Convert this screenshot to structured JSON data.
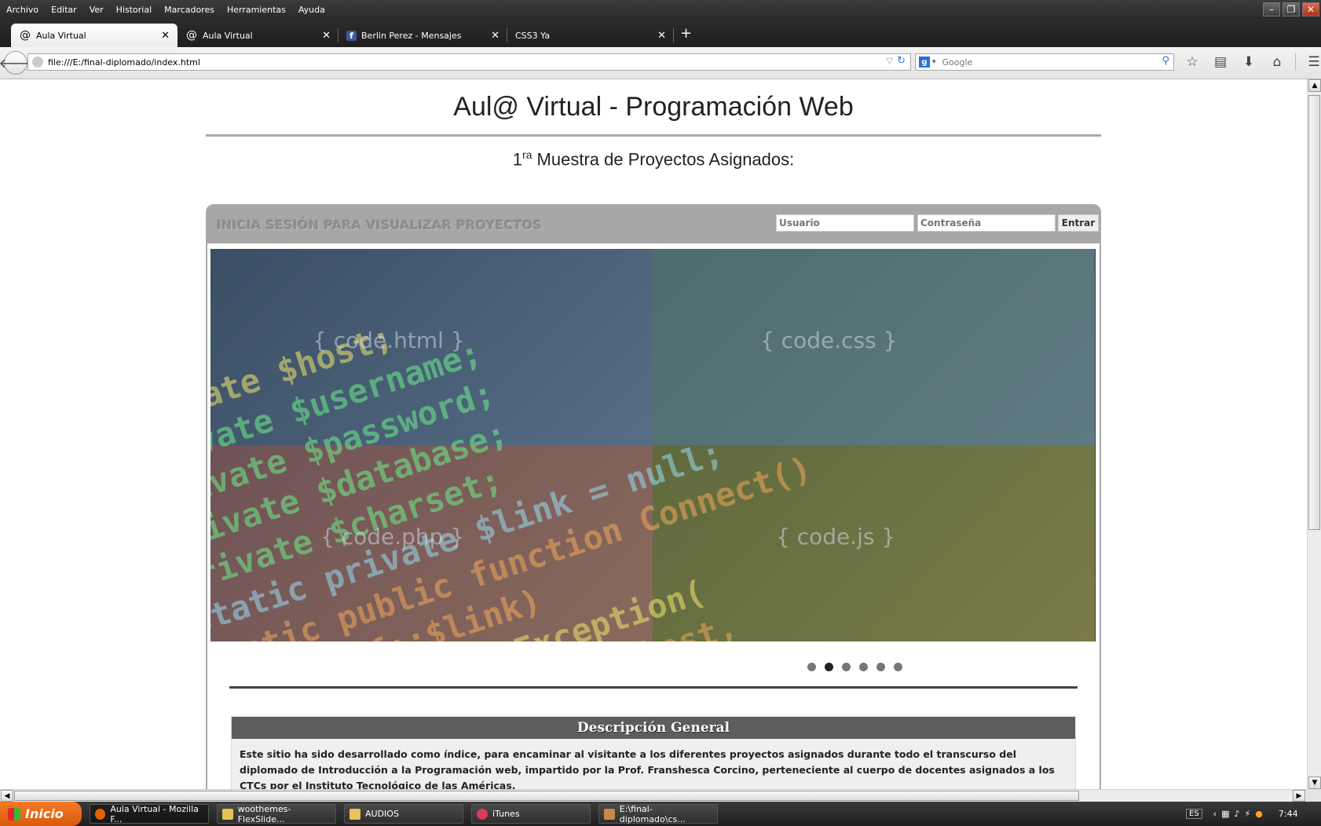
{
  "browser": {
    "menu": [
      "Archivo",
      "Editar",
      "Ver",
      "Historial",
      "Marcadores",
      "Herramientas",
      "Ayuda"
    ],
    "tabs": [
      {
        "title": "Aula Virtual",
        "icon": "at-icon",
        "active": true
      },
      {
        "title": "Aula Virtual",
        "icon": "at-icon",
        "active": false
      },
      {
        "title": "Berlin Perez - Mensajes",
        "icon": "facebook-icon",
        "active": false
      },
      {
        "title": "CSS3 Ya",
        "icon": "",
        "active": false
      }
    ],
    "url": "file:///E:/final-diplomado/index.html",
    "search_placeholder": "Google"
  },
  "page": {
    "title": "Aul@ Virtual - Programación Web",
    "subtitle_num": "1",
    "subtitle_sup": "ra",
    "subtitle_rest": " Muestra de Proyectos Asignados:",
    "login": {
      "label": "INICIA SESIÓN PARA VISUALIZAR PROYECTOS",
      "user_placeholder": "Usuario",
      "pass_placeholder": "Contraseña",
      "button": "Entrar"
    },
    "slider": {
      "labels": [
        "{ code.html }",
        "{ code.css }",
        "{ code.php }",
        "{ code.js }"
      ],
      "code_lines": [
        "private $host;",
        "private $username;",
        "private $password;",
        "private $database;",
        "private $charset;",
        "static private $link = null;",
        "static public function Connect()",
        "if (!self::$link)",
        "throw new MysqlException(",
        "mysql_connect(self::$host,"
      ],
      "dot_count": 6,
      "active_dot": 1
    },
    "description": {
      "heading": "Descripción General",
      "text": "Este sitio ha sido desarrollado como índice, para encaminar al visitante a los diferentes proyectos asignados durante todo el transcurso del diplomado de Introducción a la Programación web, impartido por la Prof. Franshesca Corcino, perteneciente al cuerpo de docentes asignados a los CTCs por el Instituto Tecnológico de las Américas."
    }
  },
  "taskbar": {
    "start": "Inicio",
    "items": [
      {
        "label": "Aula Virtual - Mozilla F...",
        "icon": "firefox-icon",
        "color": "#e66000"
      },
      {
        "label": "woothemes-FlexSlide...",
        "icon": "folder-icon",
        "color": "#e8c15a"
      },
      {
        "label": "AUDIOS",
        "icon": "folder-icon",
        "color": "#e8c15a"
      },
      {
        "label": "iTunes",
        "icon": "itunes-icon",
        "color": "#d93b5a"
      },
      {
        "label": "E:\\final-diplomado\\cs...",
        "icon": "editor-icon",
        "color": "#c9894a"
      }
    ],
    "lang": "ES",
    "clock": "7:44"
  },
  "colors": {
    "login_bar": "#a7a7a7",
    "desc_header": "#5d5d5d",
    "start_button": "#f47a26"
  }
}
